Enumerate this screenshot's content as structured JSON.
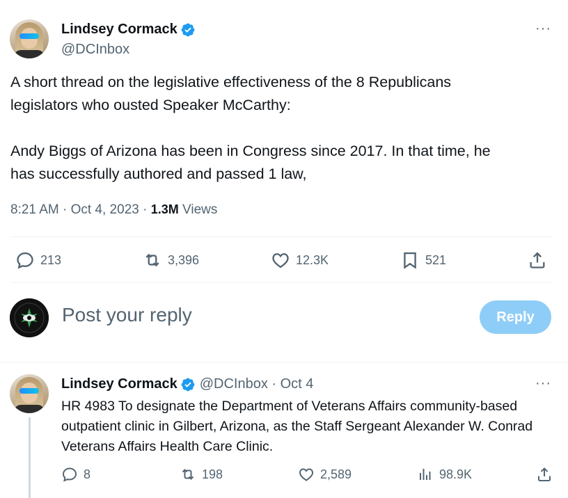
{
  "tweet": {
    "author_name": "Lindsey Cormack",
    "author_handle": "@DCInbox",
    "text_line1": "A short thread on the legislative effectiveness of the 8 Republicans",
    "text_line2": "legislators who ousted Speaker McCarthy:",
    "text_line3": "Andy Biggs of Arizona has been in Congress since 2017. In that time, he",
    "text_line4": "has successfully authored and passed 1 law,",
    "time": "8:21 AM · Oct 4, 2023 · ",
    "views_count": "1.3M",
    "views_label": " Views",
    "more_label": "···",
    "actions": {
      "replies": "213",
      "retweets": "3,396",
      "likes": "12.3K",
      "bookmarks": "521"
    },
    "icons": [
      "reply-icon",
      "retweet-icon",
      "like-icon",
      "bookmark-icon",
      "share-icon",
      "verified-icon",
      "more-icon"
    ]
  },
  "reply_composer": {
    "placeholder": "Post your reply",
    "button_label": "Reply",
    "avatar_lettering": "ARIZONA AGENDA"
  },
  "reply_tweet": {
    "author_name": "Lindsey Cormack",
    "handle_date": "@DCInbox · Oct 4",
    "more_label": "···",
    "text": "HR 4983 To designate the Department of Veterans Affairs community-based outpatient clinic in Gilbert, Arizona, as the Staff Sergeant Alexander W. Conrad Veterans Affairs Health Care Clinic.",
    "actions": {
      "replies": "8",
      "retweets": "198",
      "likes": "2,589",
      "views": "98.9K"
    }
  },
  "colors": {
    "accent": "#1d9bf0",
    "reply_button_disabled": "#8ecdf7",
    "secondary_text": "#536471",
    "border": "#eff3f4"
  }
}
